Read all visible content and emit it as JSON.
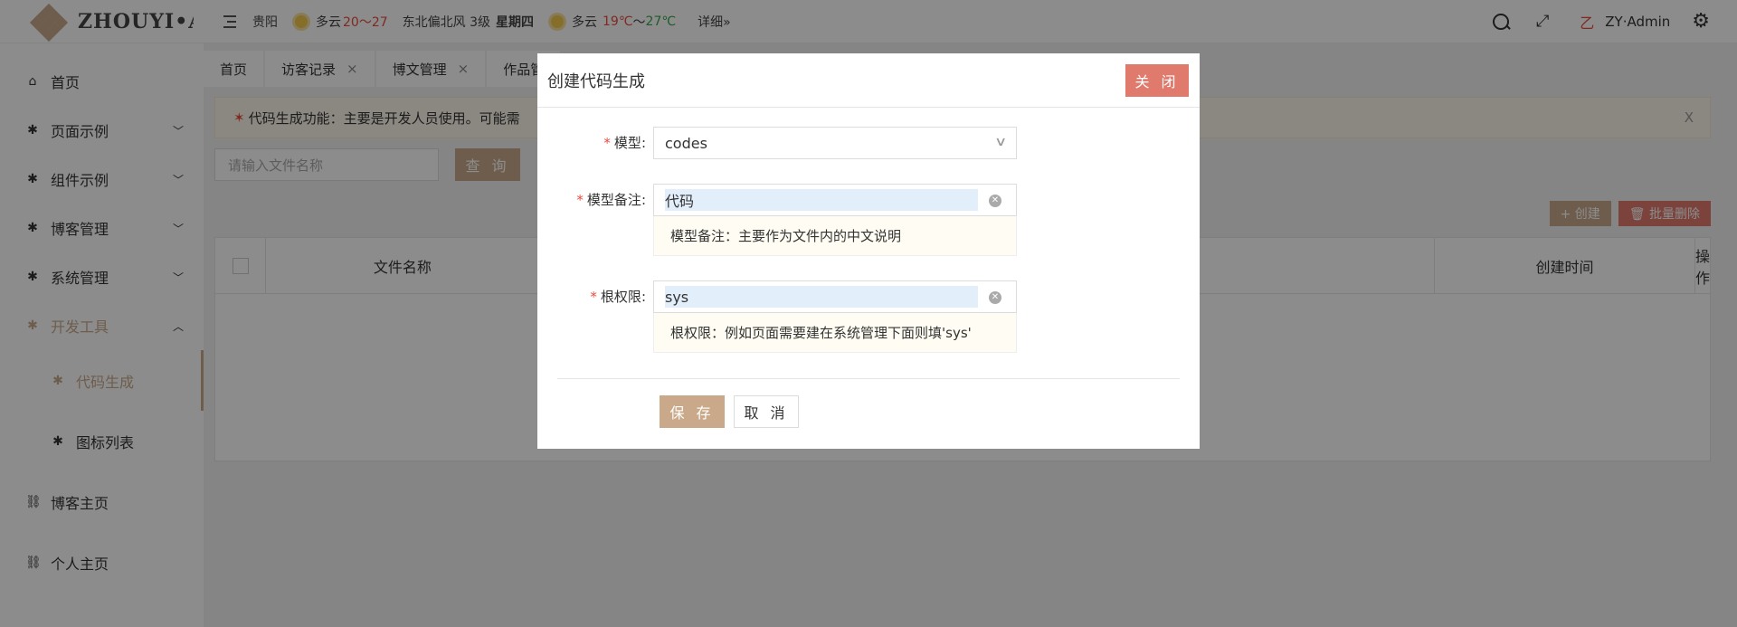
{
  "topbar": {
    "logo_text": "ZHOUYI•A",
    "weather": {
      "city": "贵阳",
      "today_cond": "多云",
      "today_temp": "20～27",
      "wind": "东北偏北风 3级",
      "weekday": "星期四",
      "next_cond": "多云",
      "next_temp_high": "19℃",
      "next_sep": "～",
      "next_temp_low": "27℃",
      "detail_link": "详细»"
    },
    "user_glyph": "乙",
    "user_name": "ZY·Admin"
  },
  "sidebar": {
    "items": [
      {
        "label": "首页",
        "icon": "home-icon",
        "glyph": "⌂"
      },
      {
        "label": "页面示例",
        "icon": "gear-icon",
        "glyph": "✱"
      },
      {
        "label": "组件示例",
        "icon": "gear-icon",
        "glyph": "✱"
      },
      {
        "label": "博客管理",
        "icon": "gear-icon",
        "glyph": "✱"
      },
      {
        "label": "系统管理",
        "icon": "gear-icon",
        "glyph": "✱"
      },
      {
        "label": "开发工具",
        "icon": "gear-icon",
        "glyph": "✱"
      },
      {
        "label": "代码生成",
        "icon": "gear-icon",
        "glyph": "✱"
      },
      {
        "label": "图标列表",
        "icon": "gear-icon",
        "glyph": "✱"
      },
      {
        "label": "博客主页",
        "icon": "link-icon",
        "glyph": "⛓"
      },
      {
        "label": "个人主页",
        "icon": "link-icon",
        "glyph": "⛓"
      }
    ]
  },
  "tabs": [
    {
      "label": "首页",
      "closable": false
    },
    {
      "label": "访客记录",
      "closable": true
    },
    {
      "label": "博文管理",
      "closable": true
    },
    {
      "label": "作品管",
      "closable": false
    }
  ],
  "tab_close_glyph": "×",
  "notice": {
    "icon": "star-icon",
    "text": "代码生成功能：主要是开发人员使用。可能需"
  },
  "filter": {
    "placeholder": "请输入文件名称",
    "query_label": "查 询"
  },
  "toolbar": {
    "create_label": "+ 创建",
    "batch_delete_label": "🗑 批量删除"
  },
  "table": {
    "columns": [
      "文件名称",
      "创建时间",
      "操作"
    ]
  },
  "dialog": {
    "title": "创建代码生成",
    "close_label": "关 闭",
    "fields": [
      {
        "label": "模型",
        "value": "codes",
        "tip": ""
      },
      {
        "label": "模型备注",
        "value": "代码",
        "tip": "模型备注：主要作为文件内的中文说明"
      },
      {
        "label": "根权限",
        "value": "sys",
        "tip": "根权限：例如页面需要建在系统管理下面则填'sys'"
      }
    ],
    "required_mark": "*",
    "label_suffix": ":",
    "save_label": "保 存",
    "cancel_label": "取 消"
  },
  "colors": {
    "accent": "#c9a98a",
    "danger": "#e07a6d",
    "required": "#e84c3d"
  }
}
